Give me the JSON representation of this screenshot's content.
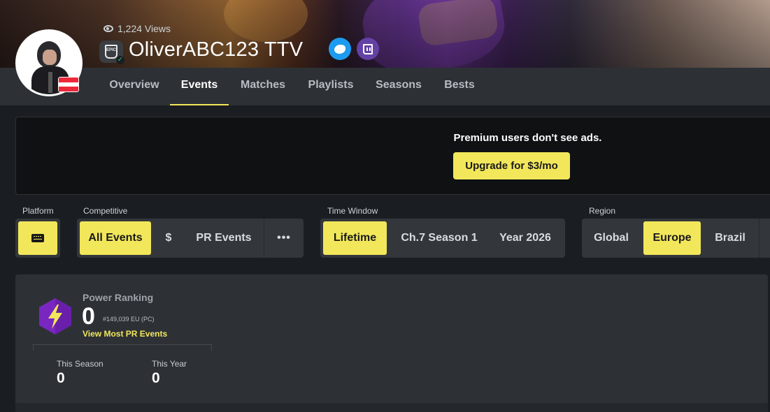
{
  "header": {
    "views": "1,224 Views",
    "username": "OliverABC123 TTV",
    "platform_badge": "EPIC",
    "verified_icon": "check-icon",
    "country_flag": "flag-austria",
    "socials": [
      {
        "name": "twitter",
        "icon": "twitter-icon",
        "color": "#1d9bf0"
      },
      {
        "name": "twitch",
        "icon": "twitch-icon",
        "color": "#6441a5"
      }
    ]
  },
  "nav": {
    "tabs": [
      {
        "label": "Overview",
        "active": false
      },
      {
        "label": "Events",
        "active": true
      },
      {
        "label": "Matches",
        "active": false
      },
      {
        "label": "Playlists",
        "active": false
      },
      {
        "label": "Seasons",
        "active": false
      },
      {
        "label": "Bests",
        "active": false
      }
    ]
  },
  "ad": {
    "text": "Premium users don't see ads.",
    "button": "Upgrade for $3/mo"
  },
  "filters": {
    "platform": {
      "label": "Platform",
      "selected_icon": "keyboard-icon"
    },
    "competitive": {
      "label": "Competitive",
      "options": [
        "All Events",
        "$",
        "PR Events"
      ],
      "selected": "All Events",
      "more_icon": "ellipsis-icon"
    },
    "time_window": {
      "label": "Time Window",
      "options": [
        "Lifetime",
        "Ch.7 Season 1",
        "Year 2026"
      ],
      "selected": "Lifetime"
    },
    "region": {
      "label": "Region",
      "options": [
        "Global",
        "Europe",
        "Brazil"
      ],
      "selected": "Europe"
    }
  },
  "power_ranking": {
    "title": "Power Ranking",
    "value": "0",
    "rank": "#149,039 EU (PC)",
    "link": "View Most PR Events",
    "icon": "lightning-icon",
    "stats": [
      {
        "label": "This Season",
        "value": "0"
      },
      {
        "label": "This Year",
        "value": "0"
      }
    ]
  },
  "colors": {
    "accent": "#f2e75a",
    "background": "#1a1d21",
    "panel": "#2d3136",
    "hex_purple": "#7a26c1"
  }
}
